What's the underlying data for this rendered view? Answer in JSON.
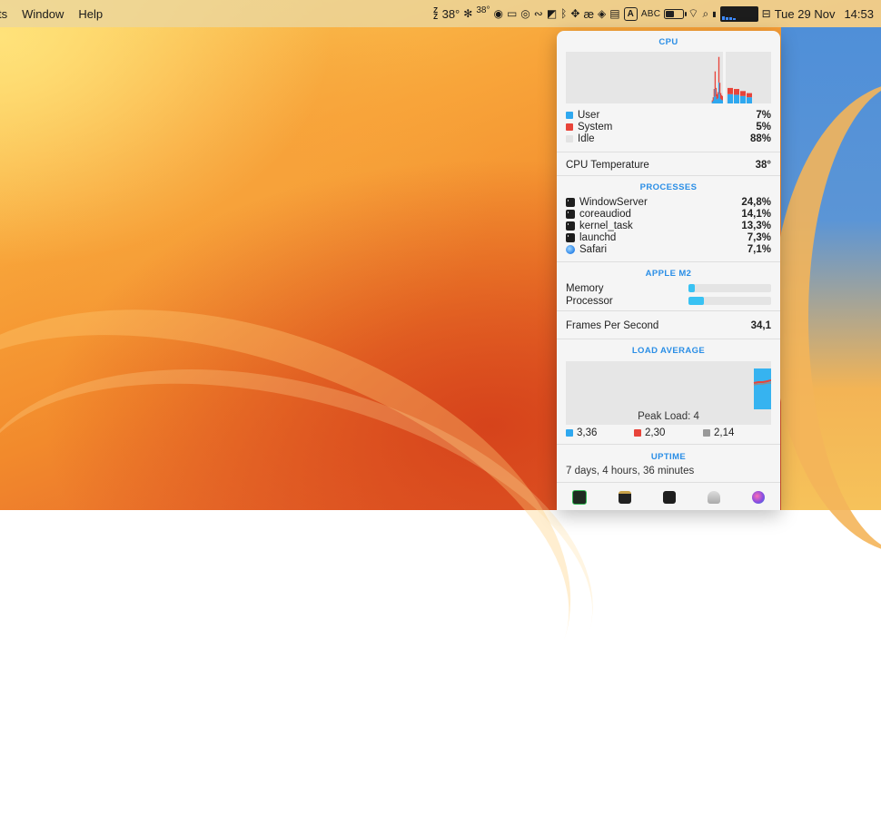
{
  "menubar": {
    "items": [
      "ts",
      "Window",
      "Help"
    ],
    "status": {
      "zz_label": "Z\nZ",
      "temp_label": "38°",
      "temp_small": "38°",
      "keyboard_box": "A",
      "input_source": "ABC",
      "date": "Tue 29 Nov",
      "time": "14:53"
    }
  },
  "cpu": {
    "title": "CPU",
    "legend": [
      {
        "name": "User",
        "value": "7%",
        "color": "#2fa8ef"
      },
      {
        "name": "System",
        "value": "5%",
        "color": "#e8443a"
      },
      {
        "name": "Idle",
        "value": "88%",
        "color": "#e3e3e3"
      }
    ],
    "graph_history": [
      0,
      0,
      0,
      0,
      0,
      0,
      0,
      0,
      0,
      0,
      0,
      0,
      0,
      0,
      0,
      0,
      0,
      0,
      0,
      0,
      0,
      0,
      0,
      0,
      0,
      0,
      0,
      0,
      0,
      0,
      0,
      0,
      0,
      0,
      0,
      0,
      0,
      0,
      0,
      0,
      0,
      0,
      0,
      0,
      0,
      0,
      0,
      0,
      0,
      0,
      0,
      0,
      0,
      0,
      0,
      0,
      0,
      0,
      0,
      0,
      0,
      0,
      0,
      0,
      0,
      0,
      0,
      0,
      0,
      0,
      0,
      0,
      0,
      0,
      0,
      0,
      0,
      0,
      0,
      0,
      0,
      0,
      0,
      0,
      0,
      0,
      0,
      0,
      0,
      0,
      0,
      0,
      0,
      0,
      0,
      0,
      0,
      0,
      0,
      0,
      0,
      0,
      0,
      0,
      0,
      0,
      0,
      0,
      0,
      0,
      0,
      0,
      0,
      0,
      0,
      0,
      0,
      0,
      0,
      0,
      0,
      0,
      0,
      0,
      0,
      0,
      0,
      0,
      0,
      0,
      0,
      0,
      0,
      0,
      0,
      0,
      0,
      0,
      0,
      0,
      0,
      0,
      0,
      0,
      0,
      0,
      0,
      0,
      0,
      0,
      0,
      0,
      0,
      0,
      0,
      0,
      6,
      12,
      28,
      62,
      30,
      18,
      22,
      90,
      40,
      20,
      16,
      14
    ],
    "graph_cores": [
      30,
      28,
      24,
      20
    ]
  },
  "cpu_temperature": {
    "label": "CPU Temperature",
    "value": "38°"
  },
  "processes": {
    "title": "PROCESSES",
    "items": [
      {
        "name": "WindowServer",
        "value": "24,8%",
        "icon": "terminal-icon"
      },
      {
        "name": "coreaudiod",
        "value": "14,1%",
        "icon": "terminal-icon"
      },
      {
        "name": "kernel_task",
        "value": "13,3%",
        "icon": "terminal-icon"
      },
      {
        "name": "launchd",
        "value": "7,3%",
        "icon": "terminal-icon"
      },
      {
        "name": "Safari",
        "value": "7,1%",
        "icon": "safari-icon"
      }
    ]
  },
  "apple_m2": {
    "title": "APPLE M2",
    "bars": [
      {
        "name": "Memory",
        "fraction": 0.08
      },
      {
        "name": "Processor",
        "fraction": 0.19
      }
    ]
  },
  "fps": {
    "label": "Frames Per Second",
    "value": "34,1"
  },
  "load_average": {
    "title": "LOAD AVERAGE",
    "peak_label": "Peak Load: 4",
    "legend": [
      {
        "value": "3,36",
        "color": "#2fa8ef"
      },
      {
        "value": "2,30",
        "color": "#e8443a"
      },
      {
        "value": "2,14",
        "color": "#999999"
      }
    ]
  },
  "uptime": {
    "title": "UPTIME",
    "value": "7 days, 4 hours, 36 minutes"
  },
  "toolbar": {
    "icons": [
      "activity-monitor-icon",
      "console-icon",
      "terminal-icon",
      "system-info-icon",
      "disk-utility-icon"
    ]
  }
}
